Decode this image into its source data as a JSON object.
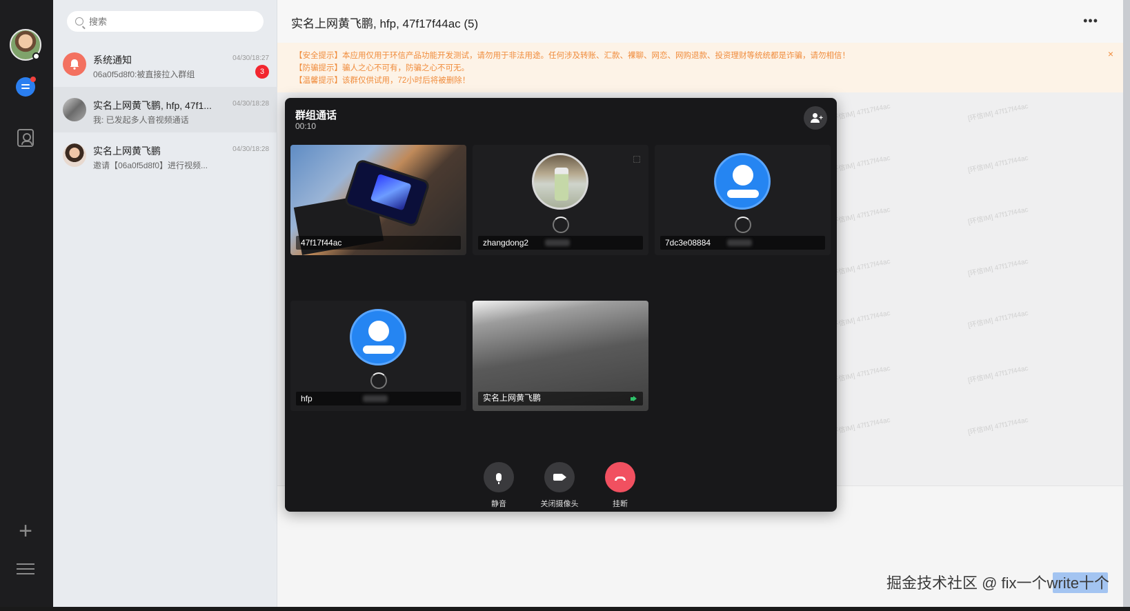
{
  "search": {
    "placeholder": "搜索"
  },
  "conversations": [
    {
      "title": "系统通知",
      "subtitle": "06a0f5d8f0:被直接拉入群组",
      "time": "04/30/18:27",
      "badge": "3"
    },
    {
      "title": "实名上网黄飞鹏, hfp, 47f1...",
      "subtitle": "我:  已发起多人音视频通话",
      "time": "04/30/18:28"
    },
    {
      "title": "实名上网黄飞鹏",
      "subtitle": "邀请【06a0f5d8f0】进行视频...",
      "time": "04/30/18:28"
    }
  ],
  "chat": {
    "title": "实名上网黄飞鹏, hfp, 47f17f44ac (5)",
    "notices": [
      "【安全提示】本应用仅用于环信产品功能开发测试，请勿用于非法用途。任何涉及转账、汇款、裸聊、网恋、网购退款、投资理财等统统都是诈骗，请勿相信！",
      "【防骗提示】骗人之心不可有，防骗之心不可无。",
      "【温馨提示】该群仅供试用，72小时后将被删除！"
    ],
    "watermark": "[环信IM] 47f17f44ac"
  },
  "call": {
    "title": "群组通话",
    "duration": "00:10",
    "participants": [
      {
        "name": "47f17f44ac",
        "type": "video"
      },
      {
        "name": "zhangdong2",
        "type": "photo-avatar"
      },
      {
        "name": "7dc3e08884",
        "type": "default-avatar"
      },
      {
        "name": "hfp",
        "type": "default-avatar"
      },
      {
        "name": "实名上网黄飞鹏",
        "type": "video"
      }
    ],
    "controls": {
      "mute": "静音",
      "camera": "关闭摄像头",
      "hangup": "挂断"
    }
  },
  "footer": {
    "watermark": "掘金技术社区 @ fix一个write十个"
  },
  "colors": {
    "accent": "#2b7ff0",
    "badge": "#f2262f",
    "notice_text": "#f08c3c",
    "hangup": "#f15060",
    "speaking": "#2ec26a"
  }
}
